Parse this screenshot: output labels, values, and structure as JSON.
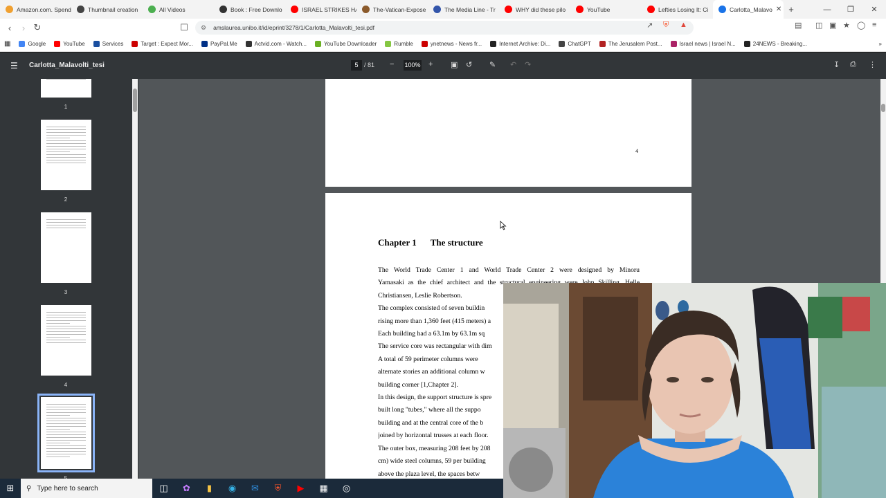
{
  "tabs": [
    {
      "label": "Amazon.com. Spend",
      "color": "#f0a030"
    },
    {
      "label": "Thumbnail creation",
      "color": "#444444"
    },
    {
      "label": "All Videos",
      "color": "#4caf50"
    },
    {
      "label": "Book : Free Downlo",
      "color": "#333333"
    },
    {
      "label": "ISRAEL STRIKES HA",
      "color": "#ff0000"
    },
    {
      "label": "The-Vatican-Expose",
      "color": "#8b5a2b"
    },
    {
      "label": "The Media Line - Tr",
      "color": "#3355aa"
    },
    {
      "label": "WHY did these pilo",
      "color": "#ff0000"
    },
    {
      "label": "YouTube",
      "color": "#ff0000"
    },
    {
      "label": "Lefties Losing It: Ci",
      "color": "#ff0000"
    },
    {
      "label": "Carlotta_Malavo",
      "color": "#1a73e8",
      "active": true
    }
  ],
  "address": {
    "url": "amslaurea.unibo.it/id/eprint/3278/1/Carlotta_Malavolti_tesi.pdf"
  },
  "bookmarks": [
    {
      "label": "Google",
      "color": "#4285f4"
    },
    {
      "label": "YouTube",
      "color": "#ff0000"
    },
    {
      "label": "Services",
      "color": "#1a4fa0"
    },
    {
      "label": "Target : Expect Mor...",
      "color": "#cc0000"
    },
    {
      "label": "PayPal.Me",
      "color": "#003087"
    },
    {
      "label": "Actvid.com - Watch...",
      "color": "#333333"
    },
    {
      "label": "YouTube Downloader",
      "color": "#6ab023"
    },
    {
      "label": "Rumble",
      "color": "#85c742"
    },
    {
      "label": "ynetnews - News fr...",
      "color": "#cc0000"
    },
    {
      "label": "Internet Archive: Di...",
      "color": "#222222"
    },
    {
      "label": "ChatGPT",
      "color": "#444444"
    },
    {
      "label": "The Jerusalem Post...",
      "color": "#b22222"
    },
    {
      "label": "Israel news | Israel N...",
      "color": "#aa2266"
    },
    {
      "label": "24NEWS - Breaking...",
      "color": "#222222"
    }
  ],
  "pdf": {
    "title": "Carlotta_Malavolti_tesi",
    "page_current": "5",
    "page_total": "/ 81",
    "zoom": "100%"
  },
  "thumbnails": [
    {
      "num": "1",
      "lines": 3
    },
    {
      "num": "2",
      "lines": 14
    },
    {
      "num": "3",
      "lines": 4
    },
    {
      "num": "4",
      "lines": 12
    },
    {
      "num": "5",
      "lines": 20,
      "selected": true
    }
  ],
  "page4": {
    "number": "4"
  },
  "page5": {
    "chapter_num": "Chapter 1",
    "chapter_title": "The structure",
    "lines": [
      "The World Trade Center 1 and World Trade Center 2 were designed by Minoru",
      "Yamasaki as the chief architect and the structural engineering were John Skilling, Helle",
      "Christiansen, Leslie Robertson.",
      "The complex consisted of seven buildin",
      "rising more than 1,360 feet (415 meters) a",
      "Each building had a 63.1m by 63.1m sq",
      "The service core was rectangular with dim",
      "A total of 59 perimeter columns were",
      "alternate stories an additional column w",
      "building corner [1,Chapter 2].",
      "In this design, the support structure is spre",
      "built long \"tubes,\" where all the suppo",
      "building and at the central core of the b",
      "joined by horizontal trusses at each floor.",
      "The outer box, measuring 208 feet by 208",
      "cm) wide steel columns, 59 per building",
      "above the plaza level, the spaces betw"
    ]
  },
  "taskbar": {
    "search_placeholder": "Type here to search"
  }
}
